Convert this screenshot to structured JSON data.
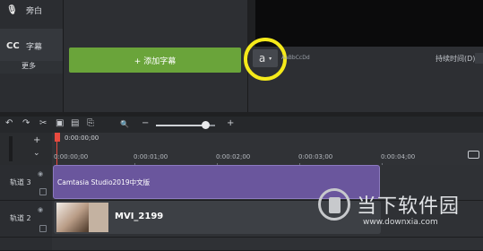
{
  "left_panel": {
    "narration": {
      "icon": "microphone-icon",
      "label": "旁白"
    },
    "captions": {
      "icon_text": "CC",
      "label": "字幕"
    },
    "more_label": "更多"
  },
  "captions_panel": {
    "add_button_label": "+ 添加字幕"
  },
  "properties": {
    "font_glyph": "a",
    "dropdown": "▾",
    "font_label": "AaBbCcDd",
    "duration_label": "持续时间(D):"
  },
  "toolbar": {
    "undo": "↶",
    "redo": "↷",
    "cut": "✂",
    "copy": "▣",
    "paste": "▤",
    "split": "⎘",
    "search": "🔍",
    "zoom_out": "−",
    "zoom_in": "+",
    "zoom_level": 0.85
  },
  "timeline": {
    "playhead_time": "0:00:00;00",
    "ticks": [
      "0:00:00;00",
      "0:00:01;00",
      "0:00:02;00",
      "0:00:03;00",
      "0:00:04;00"
    ],
    "tracks": [
      {
        "name": "轨道 3",
        "clip": "Camtasia Studio2019中文版"
      },
      {
        "name": "轨道 2",
        "clip": "MVI_2199"
      }
    ]
  },
  "watermark": {
    "text": "当下软件园",
    "url": "www.downxia.com"
  },
  "colors": {
    "accent_green": "#6aa43a",
    "highlight_ring": "#f5ea1a",
    "clip_purple": "#6a569d",
    "playhead": "#e84a3f"
  }
}
